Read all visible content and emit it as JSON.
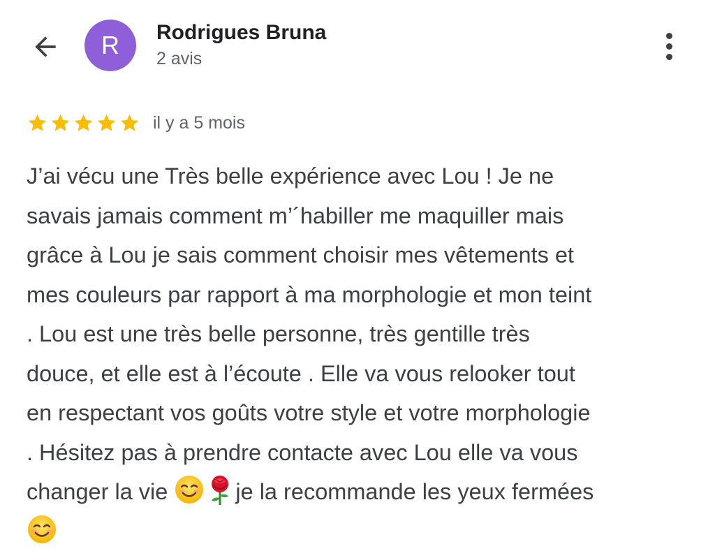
{
  "header": {
    "avatar_initial": "R",
    "avatar_color": "#8e5fd8",
    "name": "Rodrigues Bruna",
    "subtitle": "2 avis",
    "back_icon": "arrow-left-icon",
    "more_icon": "more-vert-icon"
  },
  "review": {
    "rating": 5,
    "rating_max": 5,
    "star_color": "#fbbc04",
    "time_ago": "il y a 5 mois",
    "text_lines": [
      "J’ai vécu une Très belle expérience avec Lou ! Je ne",
      "savais jamais comment m’´habiller me maquiller mais",
      "grâce à Lou je sais comment choisir mes vêtements et",
      "mes couleurs par rapport à ma morphologie et mon teint",
      ". Lou est une très belle personne, très gentille très",
      "douce, et elle est à l’écoute . Elle va vous relooker tout",
      "en respectant vos goûts votre style et votre morphologie",
      ". Hésitez pas à prendre contacte avec Lou elle va vous"
    ],
    "line9_before": "changer la vie ",
    "line9_after": "je la recommande les yeux fermées",
    "emojis": [
      "smiling-face-icon",
      "rose-icon",
      "smiling-face-icon"
    ]
  }
}
